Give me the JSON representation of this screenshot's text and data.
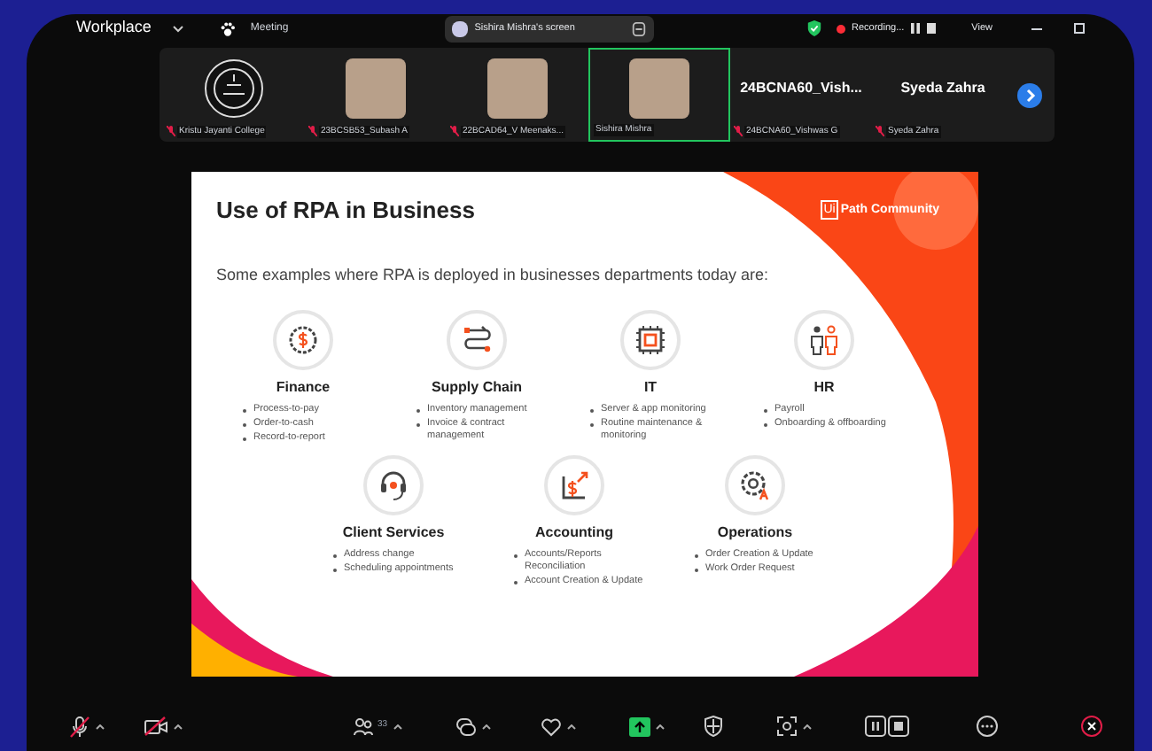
{
  "top_bar": {
    "app_name": "Workplace",
    "meeting_label": "Meeting",
    "screen_share": {
      "label": "Sishira Mishra's screen"
    },
    "recording": {
      "label": "Recording..."
    },
    "view_label": "View"
  },
  "participants": [
    {
      "kind": "logo",
      "name": "Kristu Jayanti College",
      "muted": true,
      "speaking": false
    },
    {
      "kind": "photo",
      "name": "23BCSB53_Subash A",
      "muted": true,
      "speaking": false
    },
    {
      "kind": "photo",
      "name": "22BCAD64_V Meenaks...",
      "muted": true,
      "speaking": false
    },
    {
      "kind": "photo",
      "name": "Sishira Mishra",
      "muted": false,
      "speaking": true
    },
    {
      "kind": "name",
      "display": "24BCNA60_Vish...",
      "name": "24BCNA60_Vishwas G",
      "muted": true,
      "speaking": false
    },
    {
      "kind": "name",
      "display": "Syeda Zahra",
      "name": "Syeda Zahra",
      "muted": true,
      "speaking": false
    }
  ],
  "slide": {
    "title": "Use of RPA in Business",
    "logo_mark": "Ui",
    "logo_text": "Path Community",
    "subtitle": "Some examples where RPA is deployed in businesses departments today are:",
    "rows": [
      [
        {
          "kind": "finance",
          "title": "Finance",
          "bullets": [
            "Process-to-pay",
            "Order-to-cash",
            "Record-to-report"
          ]
        },
        {
          "kind": "supply_chain",
          "title": "Supply Chain",
          "bullets": [
            "Inventory management",
            "Invoice & contract management"
          ]
        },
        {
          "kind": "it",
          "title": "IT",
          "bullets": [
            "Server & app monitoring",
            "Routine maintenance & monitoring"
          ]
        },
        {
          "kind": "hr",
          "title": "HR",
          "bullets": [
            "Payroll",
            "Onboarding & offboarding"
          ]
        }
      ],
      [
        {
          "kind": "client_services",
          "title": "Client Services",
          "bullets": [
            "Address change",
            "Scheduling appointments"
          ]
        },
        {
          "kind": "accounting",
          "title": "Accounting",
          "bullets": [
            "Accounts/Reports Reconciliation",
            "Account Creation & Update"
          ]
        },
        {
          "kind": "operations",
          "title": "Operations",
          "bullets": [
            "Order Creation & Update",
            "Work Order Request"
          ]
        }
      ]
    ]
  },
  "toolbar": {
    "mic_muted": true,
    "video_off": true,
    "participant_count": "33"
  }
}
